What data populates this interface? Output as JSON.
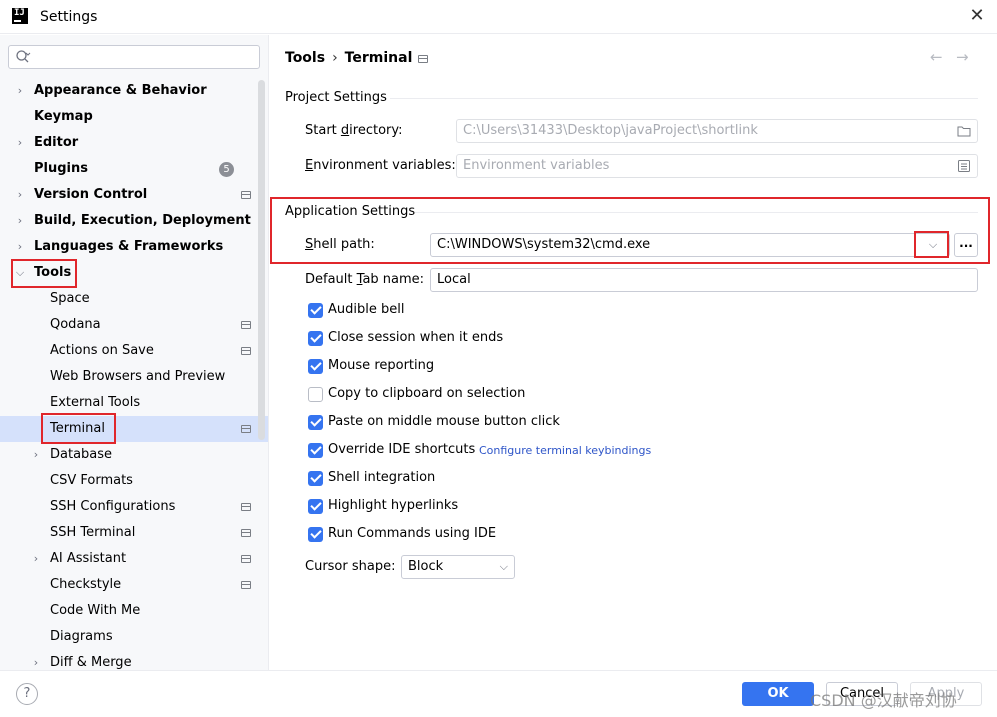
{
  "window": {
    "title": "Settings",
    "app_icon": "intellij-icon",
    "close_icon": "close-icon"
  },
  "search": {
    "placeholder": "",
    "value": ""
  },
  "sidebar": {
    "items": [
      {
        "label": "Appearance & Behavior",
        "expandable": true,
        "expanded": false,
        "bold": true
      },
      {
        "label": "Keymap",
        "bold": true
      },
      {
        "label": "Editor",
        "expandable": true,
        "expanded": false,
        "bold": true
      },
      {
        "label": "Plugins",
        "bold": true,
        "badge": "5"
      },
      {
        "label": "Version Control",
        "expandable": true,
        "expanded": false,
        "bold": true,
        "project_icon": true
      },
      {
        "label": "Build, Execution, Deployment",
        "expandable": true,
        "expanded": false,
        "bold": true
      },
      {
        "label": "Languages & Frameworks",
        "expandable": true,
        "expanded": false,
        "bold": true
      },
      {
        "label": "Tools",
        "expandable": true,
        "expanded": true,
        "bold": true
      },
      {
        "label": "Space"
      },
      {
        "label": "Qodana",
        "project_icon": true
      },
      {
        "label": "Actions on Save",
        "project_icon": true
      },
      {
        "label": "Web Browsers and Preview"
      },
      {
        "label": "External Tools"
      },
      {
        "label": "Terminal",
        "selected": true,
        "project_icon": true
      },
      {
        "label": "Database",
        "expandable": true,
        "expanded": false
      },
      {
        "label": "CSV Formats"
      },
      {
        "label": "SSH Configurations",
        "project_icon": true
      },
      {
        "label": "SSH Terminal",
        "project_icon": true
      },
      {
        "label": "AI Assistant",
        "expandable": true,
        "expanded": false,
        "project_icon": true
      },
      {
        "label": "Checkstyle",
        "project_icon": true
      },
      {
        "label": "Code With Me"
      },
      {
        "label": "Diagrams"
      },
      {
        "label": "Diff & Merge",
        "expandable": true,
        "expanded": false
      }
    ]
  },
  "breadcrumb": {
    "parent": "Tools",
    "sep": "›",
    "current": "Terminal"
  },
  "nav": {
    "back": "←",
    "forward": "→"
  },
  "project_settings": {
    "title": "Project Settings",
    "start_directory_label_pre": "Start ",
    "start_directory_label_mn": "d",
    "start_directory_label_post": "irectory:",
    "start_directory_value": "C:\\Users\\31433\\Desktop\\javaProject\\shortlink",
    "env_label_mn": "E",
    "env_label_post": "nvironment variables:",
    "env_placeholder": "Environment variables"
  },
  "application_settings": {
    "title": "Application Settings",
    "shell_label_mn": "S",
    "shell_label_post": "hell path:",
    "shell_value": "C:\\WINDOWS\\system32\\cmd.exe",
    "browse_label": "...",
    "tab_label_pre": "Default ",
    "tab_label_mn": "T",
    "tab_label_post": "ab name:",
    "tab_value": "Local",
    "checkboxes": [
      {
        "label": "Audible bell",
        "checked": true
      },
      {
        "label": "Close session when it ends",
        "checked": true
      },
      {
        "label": "Mouse reporting",
        "checked": true
      },
      {
        "label": "Copy to clipboard on selection",
        "checked": false
      },
      {
        "label": "Paste on middle mouse button click",
        "checked": true
      },
      {
        "label": "Override IDE shortcuts",
        "checked": true,
        "link": "Configure terminal keybindings"
      },
      {
        "label": "Shell integration",
        "checked": true
      },
      {
        "label": "Highlight hyperlinks",
        "checked": true
      },
      {
        "label": "Run Commands using IDE",
        "checked": true
      }
    ],
    "cursor_shape_label": "Cursor shape:",
    "cursor_shape_value": "Block"
  },
  "footer": {
    "help": "?",
    "ok": "OK",
    "cancel": "Cancel",
    "apply": "Apply",
    "watermark": "CSDN @汉献帝刘协"
  },
  "colors": {
    "accent": "#3574f0",
    "selection": "#d5e1fb",
    "highlight_box": "#e0262b",
    "link": "#2e55c8"
  }
}
